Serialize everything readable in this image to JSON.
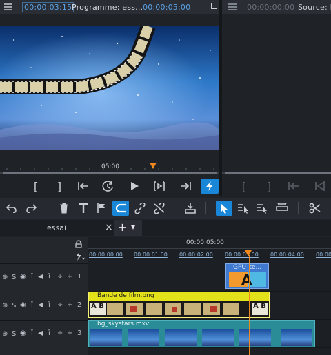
{
  "program_monitor": {
    "menu_icon": "hamburger-icon",
    "timecode_current": "00:00:03:15",
    "title": "Programme: ess...",
    "timecode_duration": "00:00:05:00",
    "ruler_label": "05:00"
  },
  "source_monitor": {
    "menu_icon": "hamburger-icon",
    "timecode": "00:00:00:00",
    "title": "Source: E("
  },
  "transport": {
    "mark_in": "[",
    "mark_out": "]"
  },
  "tabs": {
    "sequence_name": "essai",
    "close": "×",
    "add": "+",
    "dropdown": "▾"
  },
  "timeline": {
    "marker_time": "00:00:05:00",
    "ruler_ticks": [
      "00:00:00:00",
      "00:00:01:00",
      "00:00:02:00",
      "00:00:03:00",
      "00:00:04:00",
      "00:00"
    ],
    "tracks": [
      {
        "number": "1",
        "controls": "S",
        "clips": [
          {
            "name": "GPU_te...",
            "glyph": "A"
          }
        ]
      },
      {
        "number": "2",
        "controls": "S",
        "clips": [
          {
            "name": "Bande de film.png",
            "glyph": "A B"
          }
        ]
      },
      {
        "number": "3",
        "controls": "S",
        "clips": [
          {
            "name": "bg_skystars.mxv"
          }
        ]
      }
    ]
  },
  "colors": {
    "accent_blue": "#1a86d8",
    "playhead_orange": "#f08a1c",
    "clip_yellow": "#e3e11a",
    "clip_teal": "#2a8c96",
    "title_clip_blue": "#3f7ad0"
  }
}
